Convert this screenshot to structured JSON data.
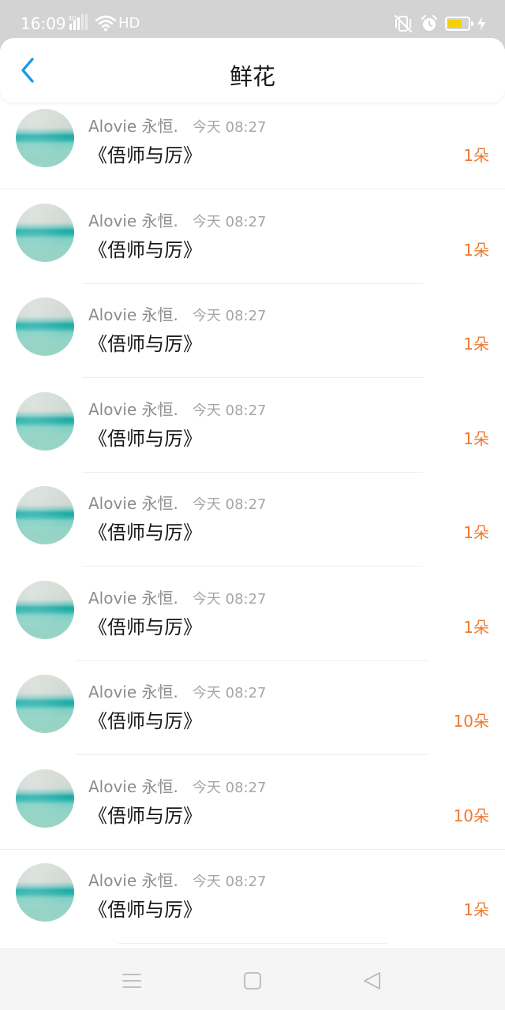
{
  "status_bar": {
    "time": "16:09",
    "network_label": "4G",
    "hd_label": "HD",
    "icons": [
      "signal-4g-icon",
      "wifi-icon",
      "vibrate-icon",
      "alarm-icon",
      "battery-icon",
      "charging-icon"
    ],
    "battery_level": 0.7,
    "battery_color": "#f5d000"
  },
  "header": {
    "title": "鲜花",
    "back_icon": "chevron-left-icon",
    "accent_color": "#1e9be8"
  },
  "list": {
    "amount_color": "#f0782d",
    "items": [
      {
        "user": "Alovie 永恒.",
        "time": "今天 08:27",
        "title": "《俉师与厉》",
        "amount": "1朵"
      },
      {
        "user": "Alovie 永恒.",
        "time": "今天 08:27",
        "title": "《俉师与厉》",
        "amount": "1朵"
      },
      {
        "user": "Alovie 永恒.",
        "time": "今天 08:27",
        "title": "《俉师与厉》",
        "amount": "1朵"
      },
      {
        "user": "Alovie 永恒.",
        "time": "今天 08:27",
        "title": "《俉师与厉》",
        "amount": "1朵"
      },
      {
        "user": "Alovie 永恒.",
        "time": "今天 08:27",
        "title": "《俉师与厉》",
        "amount": "1朵"
      },
      {
        "user": "Alovie 永恒.",
        "time": "今天 08:27",
        "title": "《俉师与厉》",
        "amount": "1朵"
      },
      {
        "user": "Alovie 永恒.",
        "time": "今天 08:27",
        "title": "《俉师与厉》",
        "amount": "10朵"
      },
      {
        "user": "Alovie 永恒.",
        "time": "今天 08:27",
        "title": "《俉师与厉》",
        "amount": "10朵"
      },
      {
        "user": "Alovie 永恒.",
        "time": "今天 08:27",
        "title": "《俉师与厉》",
        "amount": "1朵"
      }
    ]
  },
  "nav_bar": {
    "icons": [
      "menu-icon",
      "home-square-icon",
      "back-triangle-icon"
    ]
  }
}
